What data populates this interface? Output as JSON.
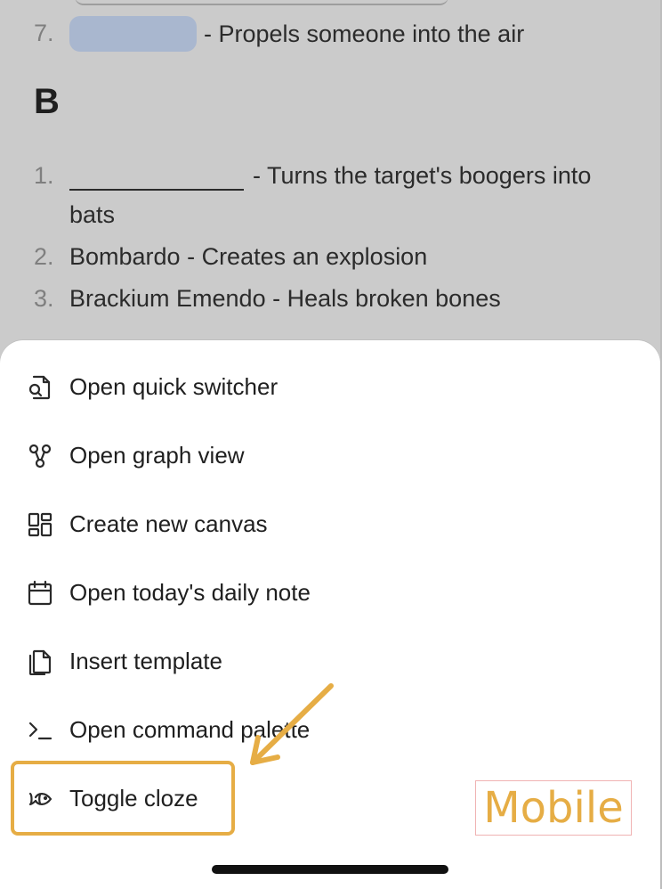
{
  "note": {
    "item7": {
      "number": "7.",
      "text": "- Propels someone into the air"
    },
    "section_heading": "B",
    "list_b": [
      {
        "number": "1.",
        "text_line1": "- Turns the target's boogers into",
        "text_line2": "bats"
      },
      {
        "number": "2.",
        "text": "Bombardo - Creates an explosion"
      },
      {
        "number": "3.",
        "text": "Brackium Emendo - Heals broken bones"
      }
    ]
  },
  "menu": {
    "items": [
      {
        "label": "Open quick switcher",
        "icon": "file-search-icon"
      },
      {
        "label": "Open graph view",
        "icon": "graph-icon"
      },
      {
        "label": "Create new canvas",
        "icon": "layout-grid-icon"
      },
      {
        "label": "Open today's daily note",
        "icon": "calendar-icon"
      },
      {
        "label": "Insert template",
        "icon": "copy-template-icon"
      },
      {
        "label": "Open command palette",
        "icon": "terminal-icon"
      },
      {
        "label": "Toggle cloze",
        "icon": "fish-icon"
      }
    ]
  },
  "annotation": {
    "mobile_label": "Mobile",
    "accent_color": "#e6ad45"
  }
}
